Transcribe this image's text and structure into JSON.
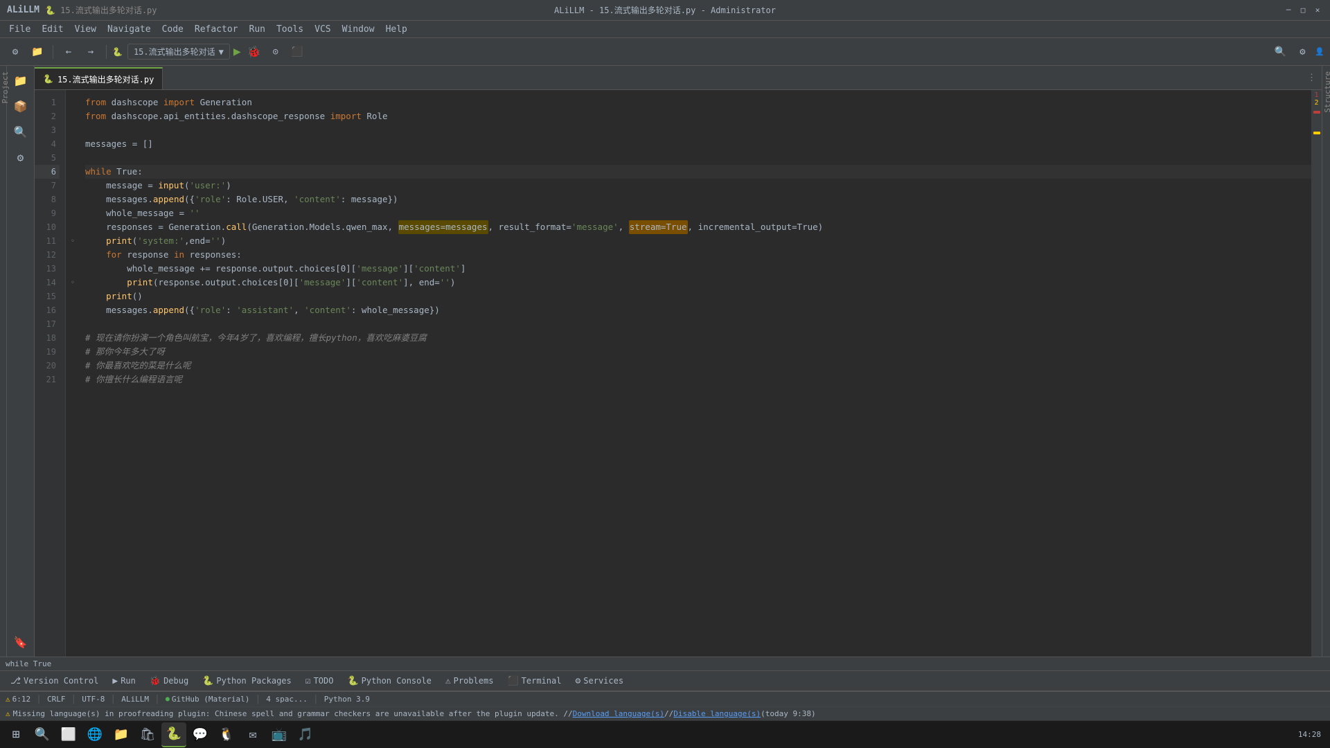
{
  "window": {
    "title": "ALiLLM - 15.流式输出多轮对话.py - Administrator",
    "app_name": "ALiLLM",
    "file_breadcrumb": "15.流式输出多轮对话.py"
  },
  "menu": {
    "items": [
      "File",
      "Edit",
      "View",
      "Navigate",
      "Code",
      "Refactor",
      "Run",
      "Tools",
      "VCS",
      "Window",
      "Help"
    ]
  },
  "toolbar": {
    "run_config": "15.流式输出多轮对话",
    "run_label": "▶",
    "debug_label": "🐞"
  },
  "tab": {
    "label": "15.流式输出多轮对话.py",
    "icon": "🐍"
  },
  "code": {
    "lines": [
      {
        "num": 1,
        "text": "from dashscope import Generation",
        "active": false
      },
      {
        "num": 2,
        "text": "from dashscope.api_entities.dashscope_response import Role",
        "active": false
      },
      {
        "num": 3,
        "text": "",
        "active": false
      },
      {
        "num": 4,
        "text": "messages = []",
        "active": false
      },
      {
        "num": 5,
        "text": "",
        "active": false
      },
      {
        "num": 6,
        "text": "while True:",
        "active": true
      },
      {
        "num": 7,
        "text": "    message = input('user:')",
        "active": false
      },
      {
        "num": 8,
        "text": "    messages.append({'role': Role.USER, 'content': message})",
        "active": false
      },
      {
        "num": 9,
        "text": "    whole_message = ''",
        "active": false
      },
      {
        "num": 10,
        "text": "    responses = Generation.call(Generation.Models.qwen_max, messages=messages, result_format='message', stream=True, incremental_output=True)",
        "active": false
      },
      {
        "num": 11,
        "text": "    print('system:',end='')",
        "active": false
      },
      {
        "num": 12,
        "text": "    for response in responses:",
        "active": false
      },
      {
        "num": 13,
        "text": "        whole_message += response.output.choices[0]['message']['content']",
        "active": false
      },
      {
        "num": 14,
        "text": "        print(response.output.choices[0]['message']['content'], end='')",
        "active": false
      },
      {
        "num": 15,
        "text": "    print()",
        "active": false
      },
      {
        "num": 16,
        "text": "    messages.append({'role': 'assistant', 'content': whole_message})",
        "active": false
      },
      {
        "num": 17,
        "text": "",
        "active": false
      },
      {
        "num": 18,
        "text": "# 现在请你扮演一个角色叫航宝，今年4岁了，喜欢编程，擅长python，喜欢吃麻婆豆腐",
        "active": false
      },
      {
        "num": 19,
        "text": "# 那你今年多大了呀",
        "active": false
      },
      {
        "num": 20,
        "text": "# 你最喜欢吃的菜是什么呢",
        "active": false
      },
      {
        "num": 21,
        "text": "# 你擅长什么编程语言呢",
        "active": false
      }
    ]
  },
  "bottom_tabs": [
    {
      "label": "Version Control",
      "icon": "⎇"
    },
    {
      "label": "Run",
      "icon": "▶"
    },
    {
      "label": "Debug",
      "icon": "🐞"
    },
    {
      "label": "Python Packages",
      "icon": "🐍"
    },
    {
      "label": "TODO",
      "icon": "☑"
    },
    {
      "label": "Python Console",
      "icon": "🐍"
    },
    {
      "label": "Problems",
      "icon": "⚠"
    },
    {
      "label": "Terminal",
      "icon": "⬛"
    },
    {
      "label": "Services",
      "icon": "⚙"
    }
  ],
  "status_bar": {
    "current_status": "while True",
    "position": "6:12",
    "line_ending": "CRLF",
    "encoding": "UTF-8",
    "theme": "ALiLLM",
    "vcs": "GitHub (Material)",
    "indent": "4 spac...",
    "language": "Python 3.9",
    "errors": "1",
    "warnings": "2"
  },
  "message_bar": {
    "text": "Missing language(s) in proofreading plugin: Chinese spell and grammar checkers are unavailable after the plugin update. // Download language(s) // Disable language(s) (today 9:38)"
  },
  "taskbar": {
    "time": "14:28"
  },
  "sidebar": {
    "icons": [
      "📁",
      "📦",
      "🔍",
      "📝",
      "⚙",
      "🔗"
    ]
  }
}
